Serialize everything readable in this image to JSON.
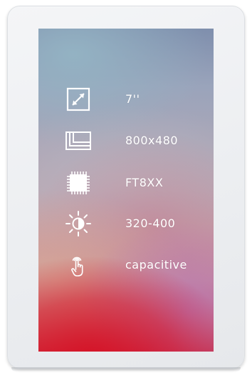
{
  "specs": [
    {
      "icon": "diagonal-resize-icon",
      "label": "7''"
    },
    {
      "icon": "resolution-layers-icon",
      "label": "800x480"
    },
    {
      "icon": "chip-icon",
      "label": "FT8XX"
    },
    {
      "icon": "brightness-icon",
      "label": "320-400"
    },
    {
      "icon": "touch-hand-icon",
      "label": "capacitive"
    }
  ]
}
